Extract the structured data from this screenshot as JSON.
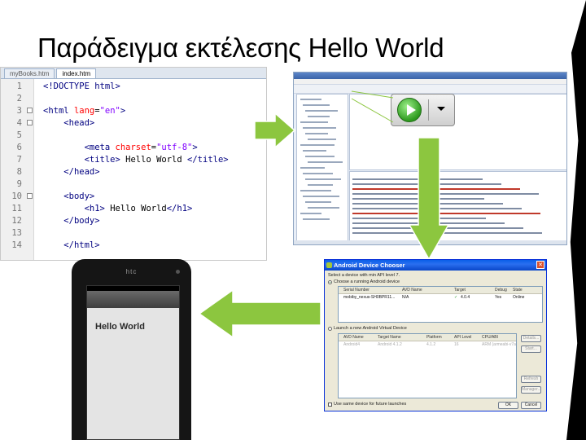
{
  "slide": {
    "title": "Παράδειγμα εκτέλεσης Hello World"
  },
  "editor": {
    "tabs": [
      "myBooks.htm",
      "index.htm"
    ],
    "lines": [
      {
        "n": "1",
        "html": "<span class='tag'>&lt;!DOCTYPE html&gt;</span>"
      },
      {
        "n": "2",
        "html": ""
      },
      {
        "n": "3",
        "html": "<span class='tag'>&lt;html</span> <span class='attr'>lang</span>=<span class='val'>\"en\"</span><span class='tag'>&gt;</span>"
      },
      {
        "n": "4",
        "html": "    <span class='tag'>&lt;head&gt;</span>"
      },
      {
        "n": "5",
        "html": ""
      },
      {
        "n": "6",
        "html": "        <span class='tag'>&lt;meta</span> <span class='attr'>charset</span>=<span class='val'>\"utf-8\"</span><span class='tag'>&gt;</span>"
      },
      {
        "n": "7",
        "html": "        <span class='tag'>&lt;title&gt;</span> Hello World <span class='tag'>&lt;/title&gt;</span>"
      },
      {
        "n": "8",
        "html": "    <span class='tag'>&lt;/head&gt;</span>"
      },
      {
        "n": "9",
        "html": ""
      },
      {
        "n": "10",
        "html": "    <span class='tag'>&lt;body&gt;</span>"
      },
      {
        "n": "11",
        "html": "        <span class='tag'>&lt;h1&gt;</span> Hello World<span class='tag'>&lt;/h1&gt;</span>"
      },
      {
        "n": "12",
        "html": "    <span class='tag'>&lt;/body&gt;</span>"
      },
      {
        "n": "13",
        "html": ""
      },
      {
        "n": "14",
        "html": "    <span class='tag'>&lt;/html&gt;</span>"
      }
    ]
  },
  "phone": {
    "brand": "htc",
    "app_text": "Hello World"
  },
  "dialog": {
    "title": "Android Device Chooser",
    "subtitle": "Select a device with min API level 7.",
    "option_running": "Choose a running Android device",
    "running_columns": [
      "Serial Number",
      "AVD Name",
      "Target",
      "Debug",
      "State"
    ],
    "running_row": [
      "mobiby_nexus-SH0BPR11...",
      "N/A",
      "4.0.4",
      "Yes",
      "Online"
    ],
    "option_avd": "Launch a new Android Virtual Device",
    "avd_columns": [
      "AVD Name",
      "Target Name",
      "Platform",
      "API Level",
      "CPU/ABI"
    ],
    "avd_row": [
      "Android4",
      "Android 4.1.2",
      "4.1.2",
      "16",
      "ARM (armeabi-v7a)"
    ],
    "side_buttons": [
      "Details...",
      "Start...",
      "Refresh",
      "Manager..."
    ],
    "footer_check": "Use same device for future launches",
    "ok": "OK",
    "cancel": "Cancel"
  },
  "colors": {
    "arrow_fill": "#8cc63f",
    "arrow_stroke": "#ffffff",
    "run_green": "#2e9a1f"
  }
}
